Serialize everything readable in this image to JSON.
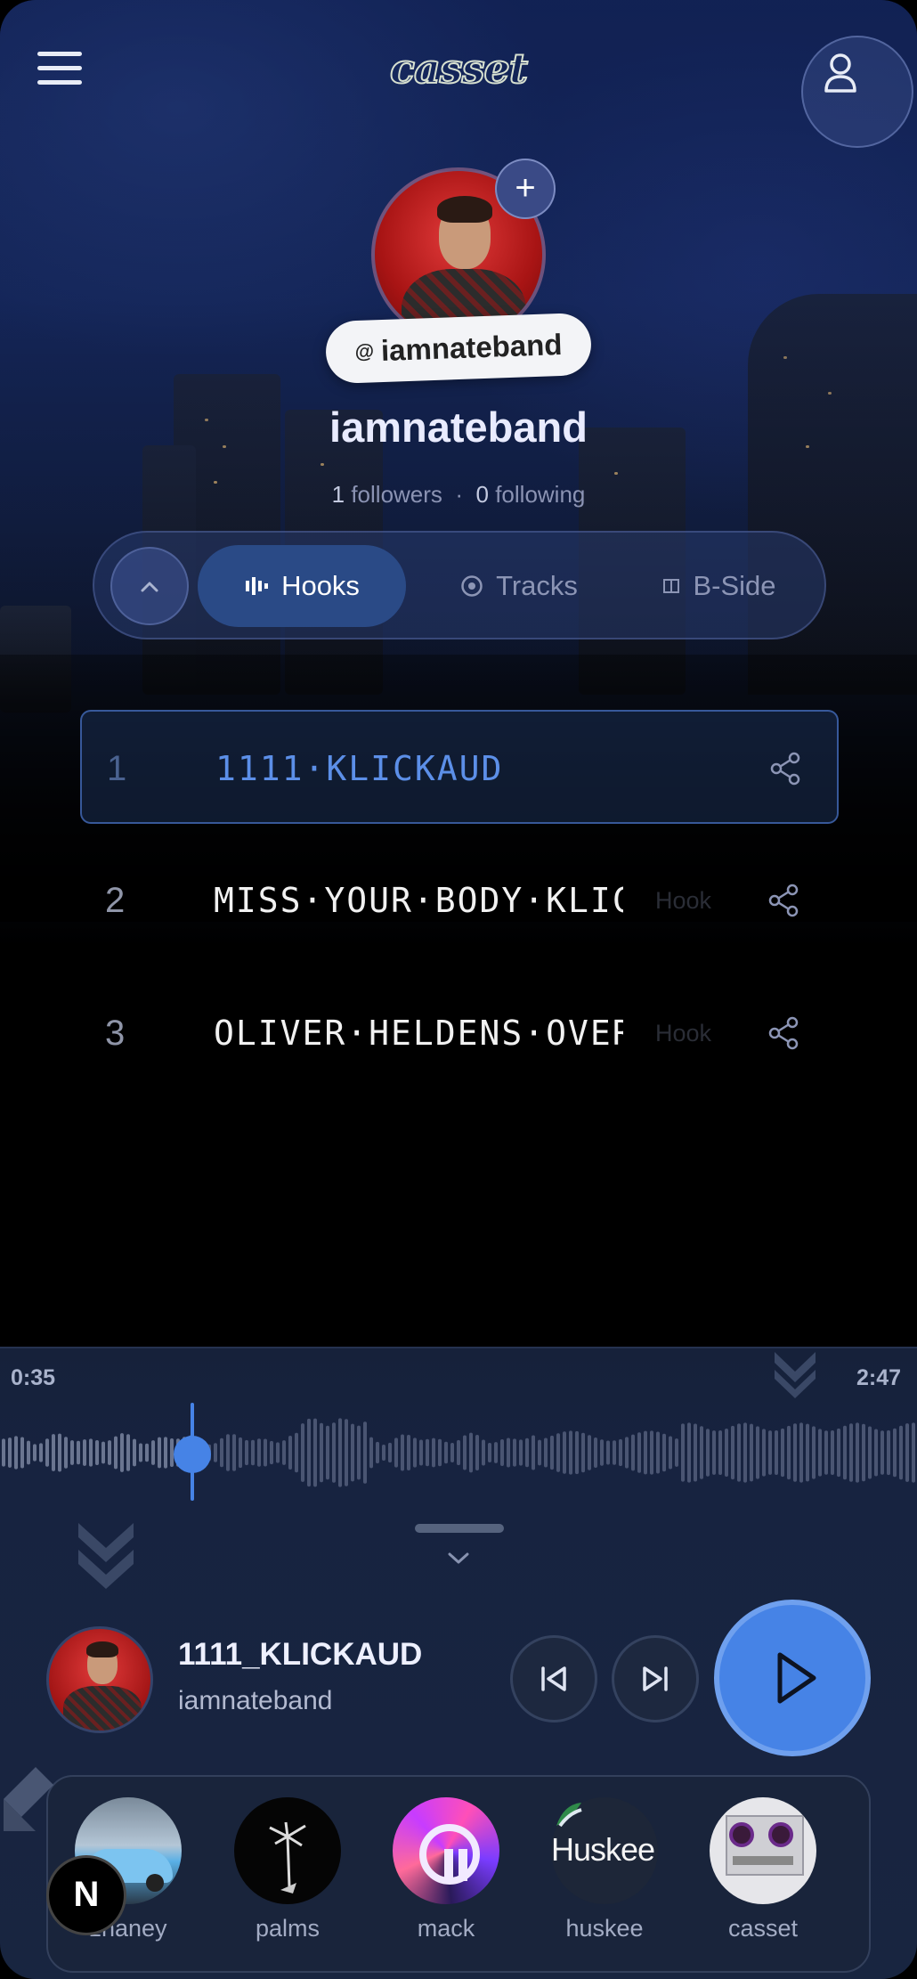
{
  "header": {
    "logo_text": "casset",
    "menu_icon": "hamburger-menu-icon",
    "account_icon": "user-icon"
  },
  "profile": {
    "handle_prefix": "@",
    "handle": "iamnateband",
    "display_name": "iamnateband",
    "followers_count": "1",
    "followers_label": "followers",
    "separator": "·",
    "following_count": "0",
    "following_label": "following",
    "add_label": "+"
  },
  "tabs": [
    {
      "label": "Hooks",
      "icon": "waveform-icon",
      "active": true
    },
    {
      "label": "Tracks",
      "icon": "disc-icon",
      "active": false
    },
    {
      "label": "B-Side",
      "icon": "cassette-icon",
      "active": false
    }
  ],
  "tracks": [
    {
      "num": "1",
      "title": "1111·KLICKAUD",
      "tag": "",
      "active": true
    },
    {
      "num": "2",
      "title": "MISS·YOUR·BODY·KLICKAUD",
      "tag": "Hook",
      "active": false
    },
    {
      "num": "3",
      "title": "OLIVER·HELDENS·OVERTIME",
      "tag": "Hook",
      "active": false
    }
  ],
  "player": {
    "elapsed": "0:35",
    "duration": "2:47",
    "progress": 0.21,
    "title": "1111_KLICKAUD",
    "artist": "iamnateband"
  },
  "dock": [
    {
      "label": "zhaney",
      "icon": "car-avatar-icon"
    },
    {
      "label": "palms",
      "icon": "palm-tree-avatar-icon"
    },
    {
      "label": "mack",
      "icon": "abstract-avatar-icon"
    },
    {
      "label": "huskee",
      "icon": "huskee-logo-icon",
      "logo_text": "Huskee"
    },
    {
      "label": "casset",
      "icon": "tape-deck-avatar-icon"
    }
  ],
  "badge": {
    "text": "N"
  },
  "colors": {
    "accent": "#4683e6",
    "panel": "#182540",
    "tab_active": "#2a4a86"
  }
}
